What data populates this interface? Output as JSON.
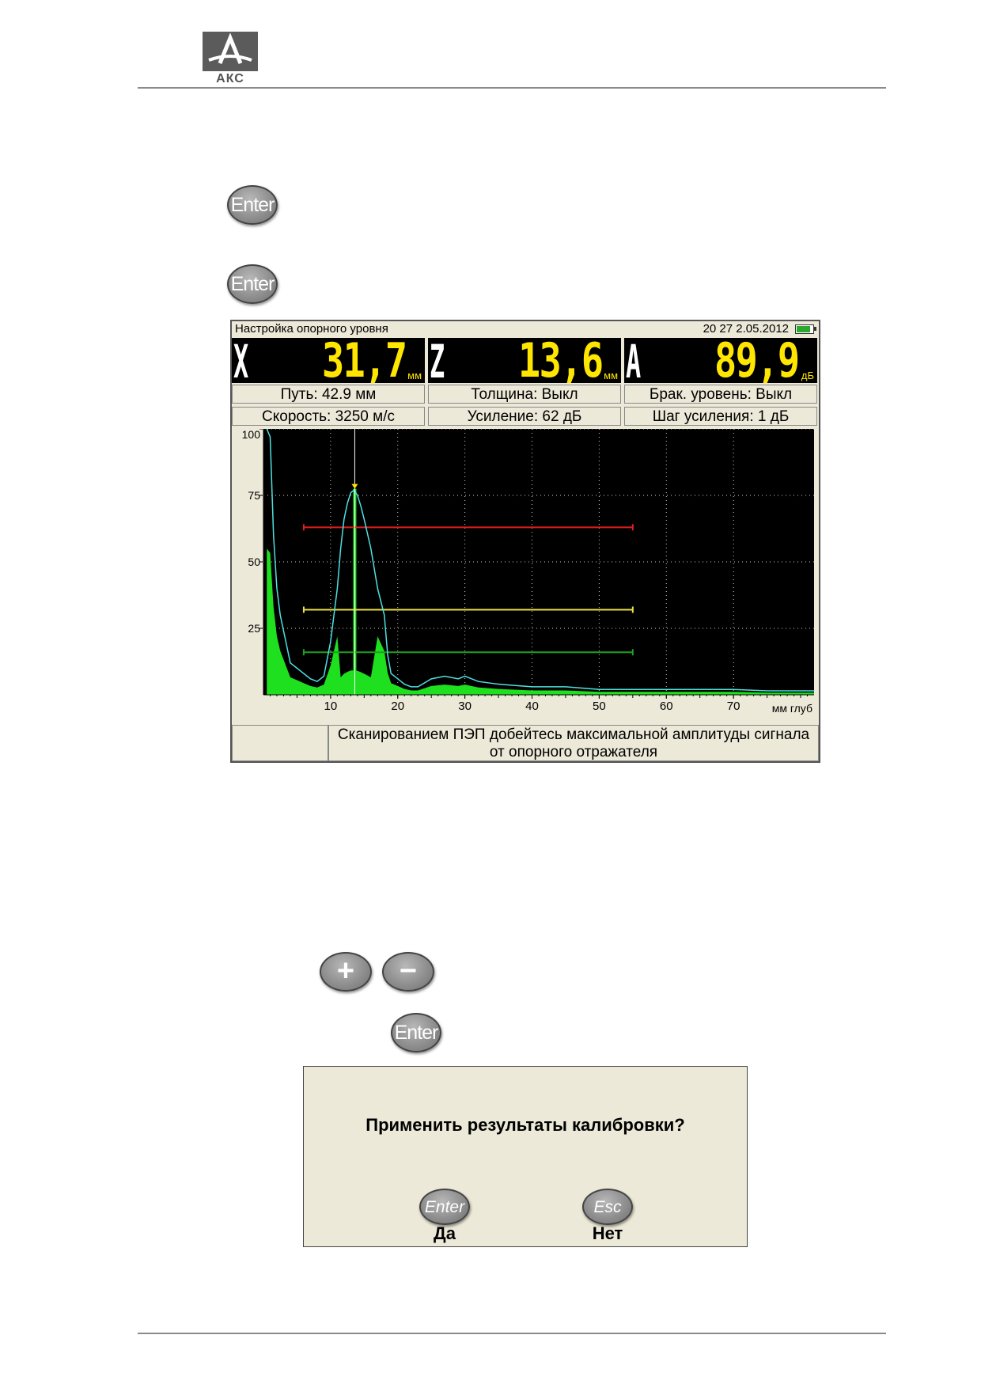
{
  "logo": {
    "text": "АКС"
  },
  "keys": {
    "enter1": "Enter",
    "enter2": "Enter",
    "plus": "+",
    "minus": "−",
    "enter3": "Enter"
  },
  "screen": {
    "title": "Настройка опорного уровня",
    "datetime": "20 27  2.05.2012",
    "readouts": [
      {
        "axis": "X",
        "value": "31,7",
        "unit": "мм"
      },
      {
        "axis": "Z",
        "value": "13,6",
        "unit": "мм"
      },
      {
        "axis": "A",
        "value": "89,9",
        "unit": "дБ"
      }
    ],
    "params": {
      "path": "Путь: 42.9 мм",
      "thickness": "Толщина: Выкл",
      "reject": "Брак. уровень: Выкл",
      "speed": "Скорость: 3250 м/с",
      "gain": "Усиление: 62 дБ",
      "gain_step": "Шаг усиления: 1 дБ"
    },
    "status_message": "Сканированием ПЭП добейтесь максимальной амплитуды сигнала от опорного отражателя"
  },
  "chart_data": {
    "type": "line",
    "xlabel": "мм глуб",
    "xlim": [
      0,
      82
    ],
    "ylim": [
      0,
      100
    ],
    "x_ticks": [
      "10",
      "20",
      "30",
      "40",
      "50",
      "60",
      "70"
    ],
    "y_ticks": [
      "100",
      "75",
      "50",
      "25"
    ],
    "grid": true,
    "series": [
      {
        "color": "#4fe0e0",
        "x": [
          0.5,
          1,
          1.5,
          2,
          2.5,
          3,
          3.5,
          4,
          5,
          6,
          7,
          8,
          9,
          10,
          11,
          11.5,
          12,
          12.5,
          13,
          13.5,
          14,
          14.5,
          15,
          16,
          17,
          18,
          18.5,
          19,
          20,
          21,
          22,
          23,
          25,
          27,
          29,
          30,
          32,
          35,
          40,
          45,
          50,
          55,
          60,
          65,
          70,
          75,
          82
        ],
        "y": [
          100,
          97,
          60,
          40,
          30,
          24,
          18,
          12,
          10,
          8,
          6,
          5,
          7,
          20,
          40,
          55,
          66,
          72,
          76,
          77,
          75,
          71,
          66,
          55,
          40,
          30,
          15,
          8,
          6,
          4,
          3,
          3,
          6,
          7,
          6,
          7,
          5,
          4,
          3,
          3,
          2,
          2,
          2,
          2,
          2,
          1.5,
          1.5
        ]
      }
    ],
    "gates": [
      {
        "color": "#e01e1e",
        "x": [
          6,
          55
        ],
        "y": 63
      },
      {
        "color": "#e8e040",
        "x": [
          6,
          55
        ],
        "y": 32
      },
      {
        "color": "#1ea01e",
        "x": [
          6,
          55
        ],
        "y": 16
      }
    ],
    "cursor": {
      "x": 13.6,
      "y": 77.5
    },
    "fill_color": "#1ee01e"
  },
  "dialog": {
    "question": "Применить результаты калибровки?",
    "yes_key": "Enter",
    "yes_label": "Да",
    "no_key": "Esc",
    "no_label": "Нет"
  }
}
